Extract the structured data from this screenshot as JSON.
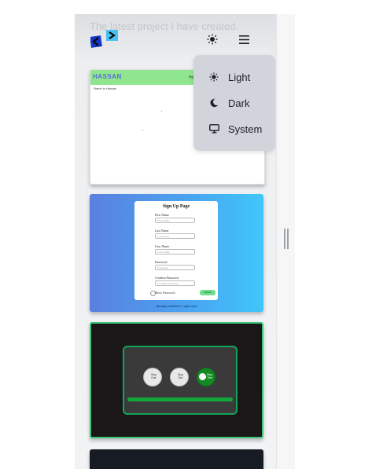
{
  "header": {
    "subtitle": "The latest project I have created.",
    "logo_icon": "code-brackets-logo",
    "theme_icon": "sun-icon",
    "menu_icon": "hamburger-icon"
  },
  "theme_menu": {
    "items": [
      {
        "label": "Light",
        "icon": "sun-icon"
      },
      {
        "label": "Dark",
        "icon": "moon-icon"
      },
      {
        "label": "System",
        "icon": "monitor-icon"
      }
    ]
  },
  "projects": {
    "card1": {
      "brand": "HASSAN",
      "nav_text": "Hom",
      "small_text": "Name is Hassan"
    },
    "card2": {
      "title": "Sign Up Page",
      "fields": [
        {
          "label": "First Name",
          "placeholder": "First Name"
        },
        {
          "label": "Last Name",
          "placeholder": "Last Name"
        },
        {
          "label": "User Name",
          "placeholder": "User Name"
        },
        {
          "label": "Password",
          "placeholder": "Password"
        },
        {
          "label": "Confirm Password",
          "placeholder": "Confirm Password"
        }
      ],
      "show_password": "Show Password",
      "submit": "Submit",
      "login_text": "Already member? Login here"
    },
    "card3": {
      "knobs": [
        "Stop One",
        "Stop Two",
        "Stop Thre"
      ],
      "progress_fraction": 1.0
    }
  },
  "colors": {
    "accent_green": "#8fe68f",
    "menu_bg": "#d1d4da"
  }
}
